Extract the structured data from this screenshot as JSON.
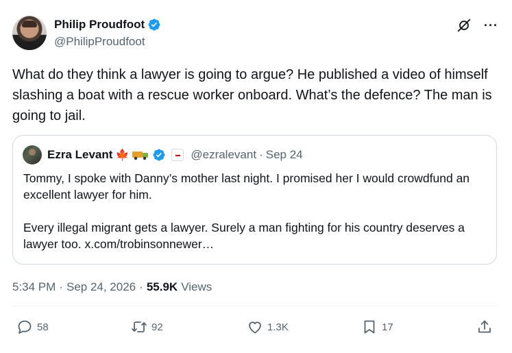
{
  "author": {
    "name": "Philip Proudfoot",
    "handle": "@PhilipProudfoot"
  },
  "tweet": {
    "text": "What do they think a lawyer is going to argue? He published a video of himself slashing a boat with a rescue worker onboard. What’s the defence? The man is going to jail."
  },
  "quoted": {
    "name": "Ezra Levant",
    "handle": "@ezralevant",
    "separator": "·",
    "date": "Sep 24",
    "paragraph1": "Tommy, I spoke with Danny’s mother last night. I promised her I would crowdfund an excellent lawyer for him.",
    "paragraph2": "Every illegal migrant gets a lawyer. Surely a man fighting for his country deserves a lawyer too. x.com/trobinsonnewer…"
  },
  "meta": {
    "time": "5:34 PM",
    "sep1": "·",
    "date": "Sep 24, 2026",
    "sep2": "·",
    "views_count": "55.9K",
    "views_label": "Views"
  },
  "actions": {
    "replies": "58",
    "reposts": "92",
    "likes": "1.3K",
    "bookmarks": "17"
  },
  "colors": {
    "verified": "#1d9bf0",
    "text": "#0f1419",
    "secondary": "#536471",
    "border": "#cfd9de"
  },
  "icons": [
    "verified-badge-icon",
    "grok-icon",
    "more-icon",
    "maple-leaf-icon",
    "truck-icon",
    "affiliate-badge-icon",
    "reply-icon",
    "repost-icon",
    "like-icon",
    "bookmark-icon",
    "share-icon"
  ]
}
